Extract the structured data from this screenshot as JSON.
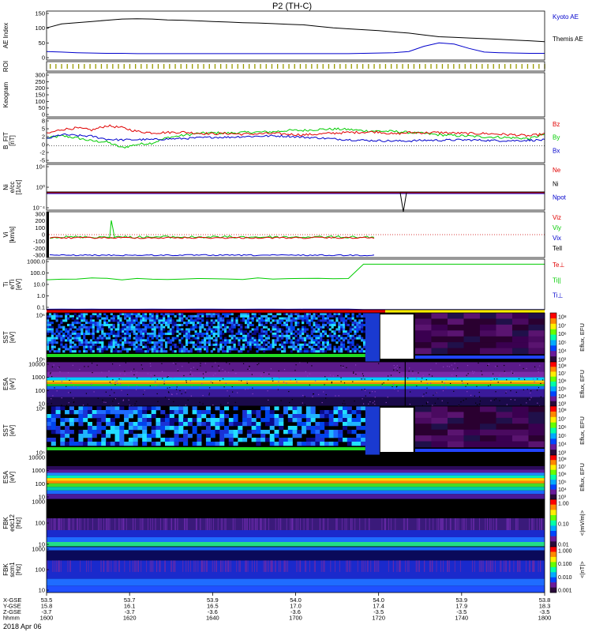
{
  "chart_data": {
    "type": "line",
    "title": "P2 (TH-C)",
    "date_label": "2018 Apr 06",
    "colors": {
      "red": "#e00000",
      "green": "#00cc00",
      "blue": "#0000cc",
      "black": "#000000",
      "yellow": "#ffee00"
    },
    "panels": [
      {
        "id": "ae",
        "ylabel": [
          "AE Index"
        ],
        "yticks": [
          "0",
          "50",
          "100",
          "150"
        ],
        "legend": [
          {
            "text": "Kyoto AE",
            "color": "#0000cc"
          },
          {
            "text": "Themis AE",
            "color": "#000000"
          }
        ]
      },
      {
        "id": "roi",
        "ylabel": [
          "ROI"
        ],
        "yticks": [],
        "legend": []
      },
      {
        "id": "kgram",
        "ylabel": [
          "Keogram"
        ],
        "yticks": [
          "0",
          "50",
          "100",
          "150",
          "200",
          "250",
          "300"
        ],
        "legend": []
      },
      {
        "id": "bfit",
        "ylabel": [
          "B_FIT",
          "[nT]"
        ],
        "yticks": [
          "-5",
          "-2",
          "0",
          "2",
          "5",
          "8"
        ],
        "legend": [
          {
            "text": "Bz",
            "color": "#e00000"
          },
          {
            "text": "By",
            "color": "#00cc00"
          },
          {
            "text": "Bx",
            "color": "#0000cc"
          }
        ]
      },
      {
        "id": "ni",
        "ylabel": [
          "Ni",
          "e/cc",
          "[1/cc]"
        ],
        "yticks": [
          "10⁻⁴",
          "10⁰",
          "10⁴"
        ],
        "legend": [
          {
            "text": "Ne",
            "color": "#e00000"
          },
          {
            "text": "Ni",
            "color": "#000000"
          },
          {
            "text": "Npot",
            "color": "#0000cc"
          }
        ]
      },
      {
        "id": "vi",
        "ylabel": [
          "Vi",
          "[km/s]"
        ],
        "yticks": [
          "-300",
          "-200",
          "-100",
          "0",
          "100",
          "200",
          "300"
        ],
        "legend": [
          {
            "text": "Viz",
            "color": "#e00000"
          },
          {
            "text": "Viy",
            "color": "#00cc00"
          },
          {
            "text": "Vix",
            "color": "#0000cc"
          },
          {
            "text": "Tell",
            "color": "#000000"
          }
        ]
      },
      {
        "id": "ti",
        "ylabel": [
          "Ti",
          "e/Ti",
          "[eV]"
        ],
        "yticks": [
          "0.1",
          "1.0",
          "10.0",
          "100.0",
          "1000.0"
        ],
        "legend": [
          {
            "text": "Te⊥",
            "color": "#e00000"
          },
          {
            "text": "Ti||",
            "color": "#00cc00"
          },
          {
            "text": "Ti⊥",
            "color": "#0000cc"
          }
        ]
      },
      {
        "id": "sst1",
        "ylabel": [
          "SST",
          "[eV]"
        ],
        "yticks": [
          "10⁵",
          "10⁶"
        ],
        "cbar_ticks": [
          "10⁸",
          "10⁷",
          "10⁶",
          "10⁵",
          "10⁴",
          "10³"
        ],
        "cbar_label": "Eflux, EFU"
      },
      {
        "id": "esa1",
        "ylabel": [
          "ESA",
          "[eV]"
        ],
        "yticks": [
          "10",
          "100",
          "1000",
          "10000"
        ],
        "cbar_ticks": [
          "10⁸",
          "10⁷",
          "10⁶",
          "10⁵",
          "10⁴",
          "10³"
        ],
        "cbar_label": "Eflux, EFU"
      },
      {
        "id": "sst2",
        "ylabel": [
          "SST",
          "[eV]"
        ],
        "yticks": [
          "10⁵",
          "10⁶"
        ],
        "cbar_ticks": [
          "10⁸",
          "10⁷",
          "10⁶",
          "10⁵",
          "10⁴",
          "10³"
        ],
        "cbar_label": "Eflux, EFU"
      },
      {
        "id": "esa2",
        "ylabel": [
          "ESA",
          "[eV]"
        ],
        "yticks": [
          "10",
          "100",
          "1000",
          "10000"
        ],
        "cbar_ticks": [
          "10⁸",
          "10⁷",
          "10⁶",
          "10⁵",
          "10⁴",
          "10³"
        ],
        "cbar_label": "Eflux, EFU"
      },
      {
        "id": "fbk1",
        "ylabel": [
          "FBK",
          "edc12",
          "[Hz]"
        ],
        "yticks": [
          "10",
          "100",
          "1000"
        ],
        "cbar_ticks": [
          "1.00",
          "0.10",
          "0.01"
        ],
        "cbar_label": "<|mV/m|>"
      },
      {
        "id": "fbk2",
        "ylabel": [
          "FBK",
          "scm1",
          "[Hz]"
        ],
        "yticks": [
          "10",
          "100",
          "1000"
        ],
        "cbar_ticks": [
          "1.000",
          "0.100",
          "0.010",
          "0.001"
        ],
        "cbar_label": "<|nT|>"
      }
    ],
    "x_axis": {
      "row_labels": [
        "X-GSE",
        "Y-GSE",
        "Z-GSE",
        "hhmm"
      ],
      "ticks": [
        {
          "values": [
            "53.5",
            "15.8",
            "-3.7",
            "1600"
          ]
        },
        {
          "values": [
            "53.7",
            "16.1",
            "-3.7",
            "1620"
          ]
        },
        {
          "values": [
            "53.9",
            "16.5",
            "-3.6",
            "1640"
          ]
        },
        {
          "values": [
            "54.0",
            "17.0",
            "-3.6",
            "1700"
          ]
        },
        {
          "values": [
            "54.0",
            "17.4",
            "-3.5",
            "1720"
          ]
        },
        {
          "values": [
            "53.9",
            "17.9",
            "-3.5",
            "1740"
          ]
        },
        {
          "values": [
            "53.8",
            "18.3",
            "-3.5",
            "1800"
          ]
        }
      ]
    },
    "series": {
      "kyoto_ae": [
        105,
        118,
        122,
        126,
        130,
        134,
        135,
        134,
        131,
        130,
        128,
        126,
        124,
        122,
        121,
        119,
        117,
        115,
        110,
        105,
        102,
        99,
        96,
        92,
        88,
        82,
        76,
        74,
        72,
        70,
        68,
        65,
        63,
        60
      ],
      "themis_ae": [
        28,
        26,
        24,
        23,
        22,
        22,
        21,
        21,
        21,
        21,
        21,
        21,
        21,
        21,
        21,
        21,
        21,
        21,
        21,
        21,
        21,
        22,
        23,
        24,
        28,
        45,
        56,
        52,
        38,
        26,
        24,
        23,
        22,
        22
      ],
      "bz": [
        3.5,
        4.8,
        5.2,
        4.6,
        5.9,
        5.3,
        4.2,
        3.8,
        3.9,
        4.0,
        3.7,
        3.5,
        3.6,
        3.4,
        3.5,
        3.6,
        3.4,
        3.2,
        3.4,
        3.7,
        3.9,
        4.0,
        4.1,
        3.4,
        3.9,
        3.8,
        3.9,
        3.7,
        3.6,
        3.6,
        3.4,
        3.2,
        2.9,
        3.5
      ],
      "by": [
        2.2,
        2.9,
        2.3,
        1.4,
        1.1,
        -0.6,
        0.4,
        0.8,
        2.4,
        3.0,
        3.6,
        3.8,
        3.7,
        3.9,
        4.0,
        4.1,
        4.5,
        4.5,
        4.8,
        4.9,
        4.8,
        4.4,
        4.3,
        4.2,
        3.9,
        3.6,
        3.2,
        3.0,
        2.8,
        2.6,
        2.5,
        2.3,
        2.1,
        3.4
      ],
      "bx": [
        2.0,
        3.3,
        3.0,
        2.8,
        1.9,
        1.7,
        1.8,
        1.8,
        2.0,
        2.1,
        2.3,
        2.5,
        2.5,
        2.7,
        2.8,
        2.9,
        2.8,
        2.5,
        2.3,
        2.0,
        1.8,
        1.6,
        1.5,
        1.4,
        1.4,
        1.6,
        1.6,
        1.7,
        1.7,
        1.6,
        1.5,
        1.5,
        1.6,
        1.7
      ],
      "ti_ii": [
        30,
        42,
        40,
        45,
        43,
        38,
        41,
        44,
        40,
        38,
        42,
        45,
        41,
        40,
        44,
        43,
        40,
        43,
        42,
        44,
        45,
        1000,
        1000,
        1000,
        1000,
        1000,
        1000,
        1000,
        1000,
        1000,
        1000,
        1000,
        1000,
        1000
      ],
      "ti_perp": [
        28,
        35,
        30,
        32,
        30,
        26,
        30,
        32,
        29,
        28,
        32,
        34,
        30,
        29,
        33,
        32,
        30,
        32,
        31,
        33,
        34,
        12,
        12,
        12,
        12,
        12,
        12,
        12,
        12,
        12,
        12,
        12,
        12,
        12
      ]
    }
  }
}
